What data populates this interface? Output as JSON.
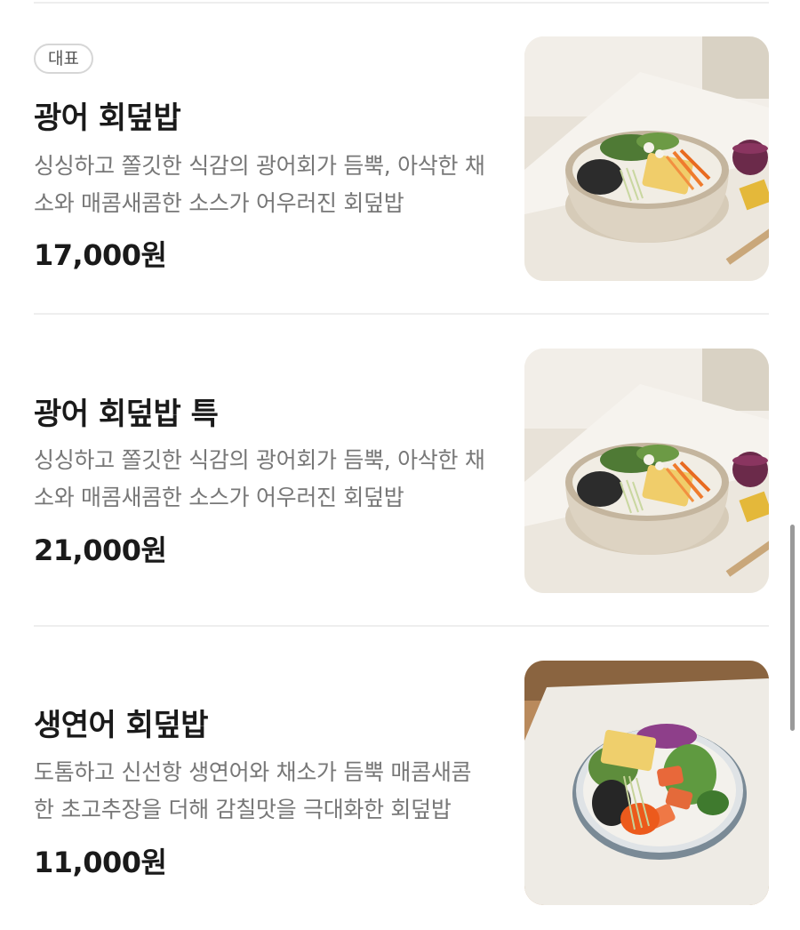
{
  "menu": {
    "items": [
      {
        "badge": "대표",
        "name": "광어 회덮밥",
        "description": "싱싱하고 쫄깃한 식감의 광어회가 듬뿍, 아삭한 채소와 매콤새콤한 소스가 어우러진 회덮밥",
        "price": "17,000원"
      },
      {
        "name": "광어 회덮밥 특",
        "description": "싱싱하고 쫄깃한 식감의 광어회가 듬뿍, 아삭한 채소와 매콤새콤한 소스가 어우러진 회덮밥",
        "price": "21,000원"
      },
      {
        "name": "생연어 회덮밥",
        "description": "도톰하고 신선항 생연어와 채소가 듬뿍 매콤새콤한 초고추장을 더해 감칠맛을 극대화한 회덮밥",
        "price": "11,000원"
      }
    ]
  },
  "colors": {
    "title": "#1a1a1a",
    "description": "#777777",
    "divider": "#eeeeee",
    "badge_border": "#d6d6d6"
  }
}
